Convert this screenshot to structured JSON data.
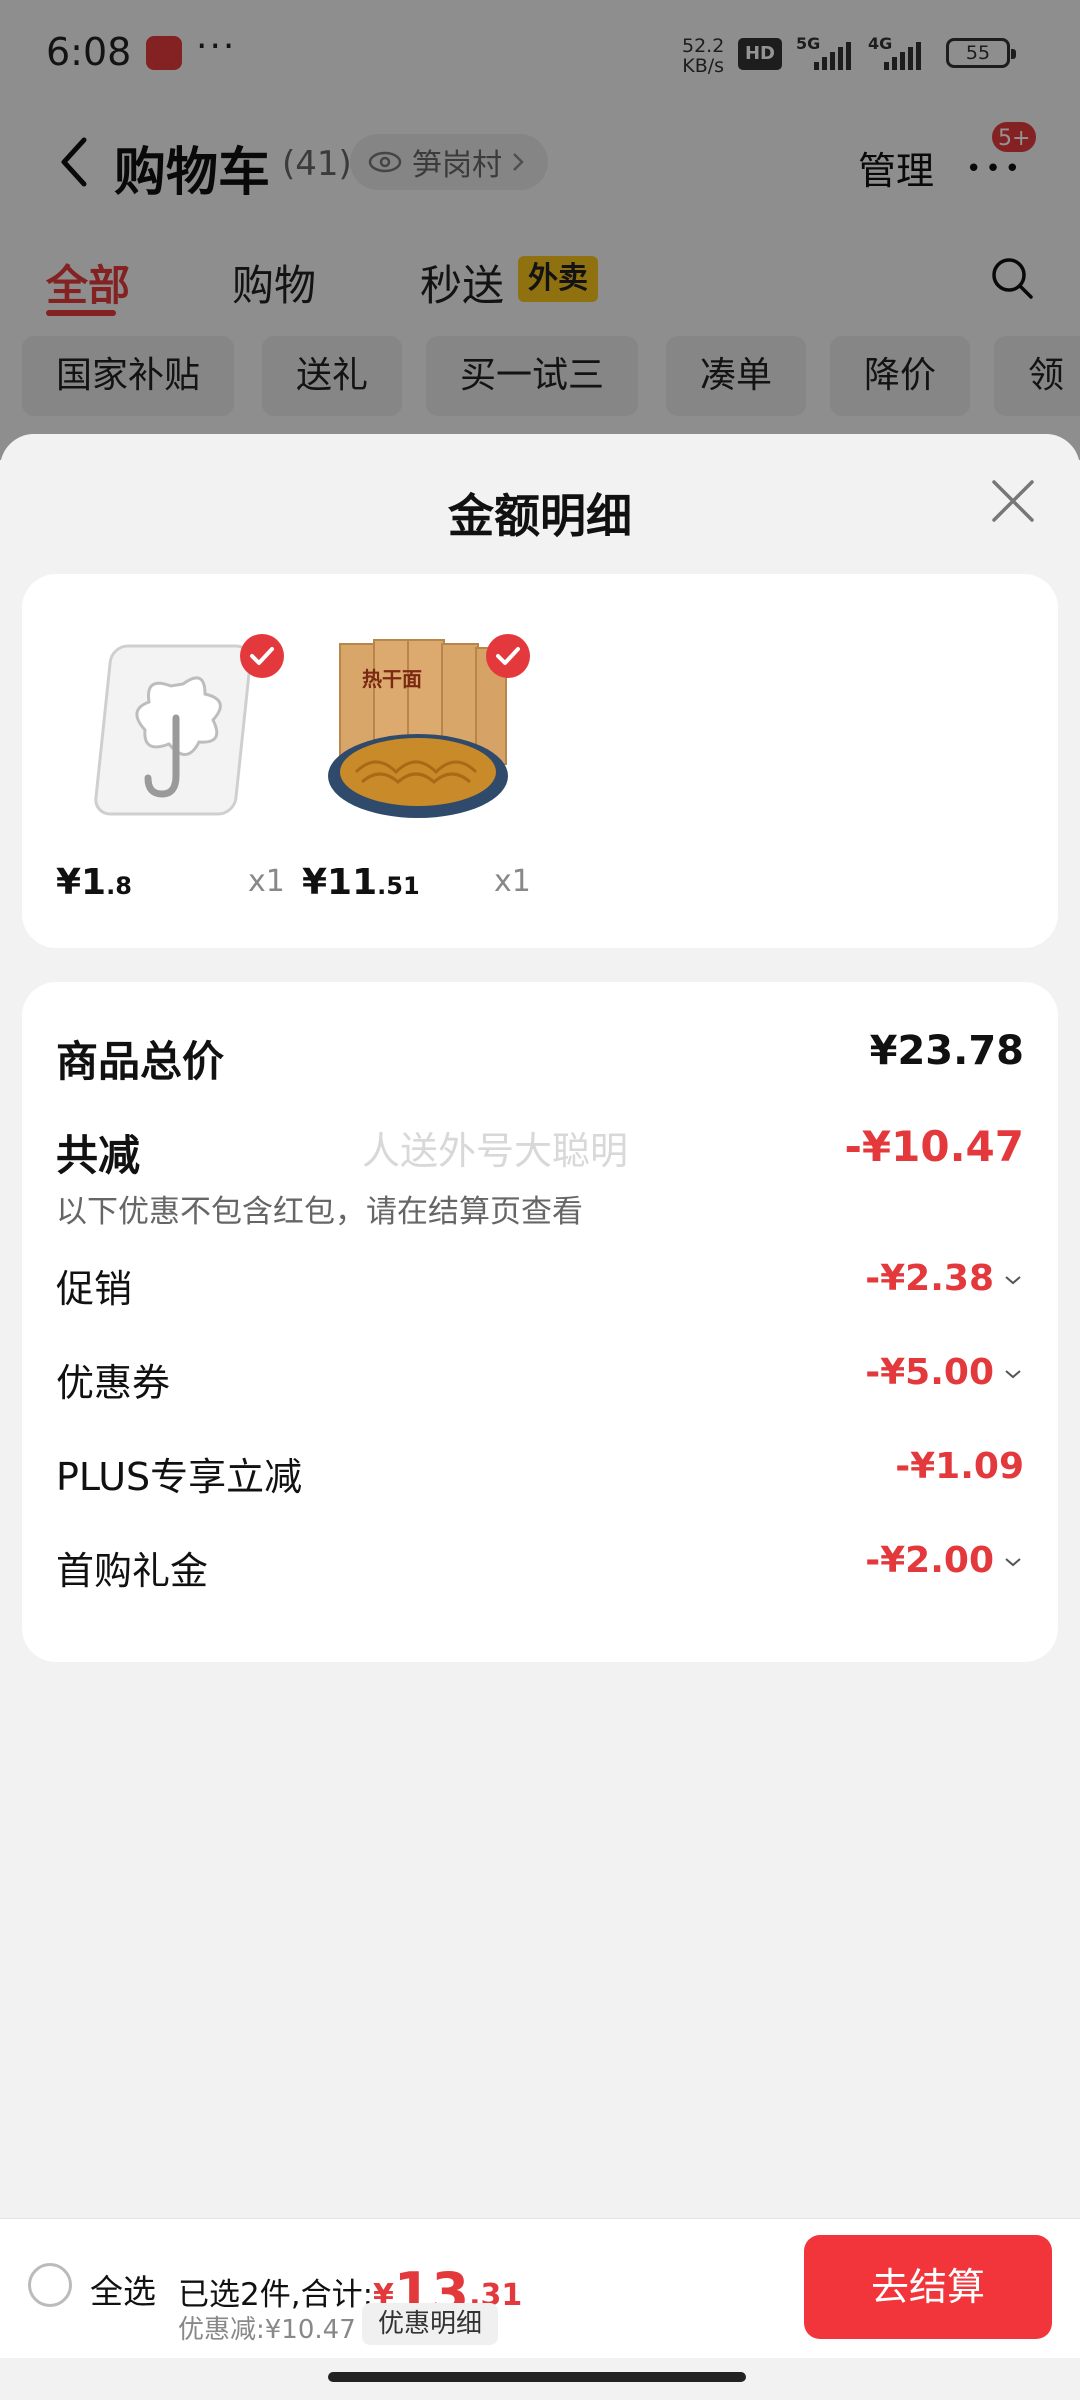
{
  "status_bar": {
    "time": "6:08",
    "dots": "···",
    "net_speed_value": "52.2",
    "net_speed_unit": "KB/s",
    "hd": "HD",
    "sig1": "5G",
    "sig2": "4G",
    "battery": "55"
  },
  "nav": {
    "title": "购物车",
    "count": "(41)",
    "location": "笋岗村",
    "manage": "管理",
    "badge": "5+"
  },
  "tabs": [
    {
      "label": "全部",
      "active": true
    },
    {
      "label": "购物"
    },
    {
      "label": "秒送"
    }
  ],
  "waimai_badge": "外卖",
  "chips": [
    "国家补贴",
    "送礼",
    "买一试三",
    "凑单",
    "降价",
    "领"
  ],
  "sheet": {
    "title": "金额明细",
    "products": [
      {
        "price_int": "¥1",
        "price_dec": ".8",
        "qty": "x1",
        "name": "hook-product"
      },
      {
        "price_int": "¥11",
        "price_dec": ".51",
        "qty": "x1",
        "name": "noodle-product",
        "package_text": "热干面"
      }
    ],
    "summary": {
      "total_label": "商品总价",
      "total_value": "¥23.78",
      "reduce_label": "共减",
      "reduce_value": "-¥10.47",
      "note": "以下优惠不包含红包，请在结算页查看",
      "watermark": "人送外号大聪明",
      "items": [
        {
          "label": "促销",
          "value": "-¥2.38",
          "expandable": true
        },
        {
          "label": "优惠券",
          "value": "-¥5.00",
          "expandable": true
        },
        {
          "label": "PLUS专享立减",
          "value": "-¥1.09",
          "expandable": false
        },
        {
          "label": "首购礼金",
          "value": "-¥2.00",
          "expandable": true
        }
      ]
    }
  },
  "bottom_bar": {
    "select_all": "全选",
    "selected_prefix": "已选2件,合计:",
    "currency": "¥",
    "total_int": "13",
    "total_dec": ".31",
    "discount": "优惠减:¥10.47",
    "detail": "优惠明细",
    "checkout": "去结算"
  },
  "colors": {
    "accent": "#e4393c",
    "checkout": "#f2353b",
    "waimai": "#f7c31a"
  }
}
